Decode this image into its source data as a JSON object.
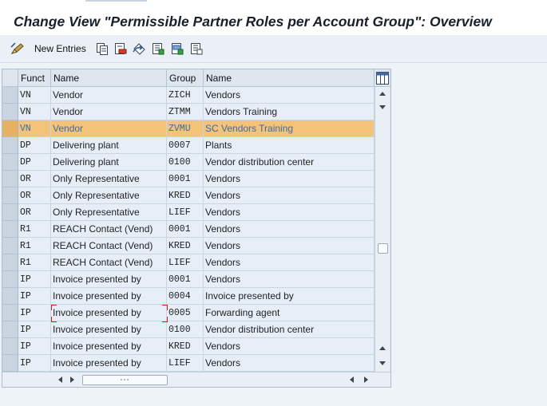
{
  "title": "Change View \"Permissible Partner Roles per Account Group\": Overview",
  "toolbar": {
    "new_entries_label": "New Entries",
    "icons": [
      "change-display-icon",
      "copy-icon",
      "delete-icon",
      "undo-icon",
      "select-all-icon",
      "select-block-icon",
      "deselect-all-icon"
    ]
  },
  "columns": [
    "Funct",
    "Name",
    "Group",
    "Name"
  ],
  "rows": [
    {
      "funct": "VN",
      "name": "Vendor",
      "group": "ZICH",
      "group_name": "Vendors",
      "selected": false
    },
    {
      "funct": "VN",
      "name": "Vendor",
      "group": "ZTMM",
      "group_name": "Vendors Training",
      "selected": false
    },
    {
      "funct": "VN",
      "name": "Vendor",
      "group": "ZVMU",
      "group_name": "SC Vendors Training",
      "selected": true
    },
    {
      "funct": "DP",
      "name": "Delivering plant",
      "group": "0007",
      "group_name": "Plants",
      "selected": false
    },
    {
      "funct": "DP",
      "name": "Delivering plant",
      "group": "0100",
      "group_name": "Vendor distribution center",
      "selected": false
    },
    {
      "funct": "OR",
      "name": "Only Representative",
      "group": "0001",
      "group_name": "Vendors",
      "selected": false
    },
    {
      "funct": "OR",
      "name": "Only Representative",
      "group": "KRED",
      "group_name": "Vendors",
      "selected": false
    },
    {
      "funct": "OR",
      "name": "Only Representative",
      "group": "LIEF",
      "group_name": "Vendors",
      "selected": false
    },
    {
      "funct": "R1",
      "name": "REACH Contact (Vend)",
      "group": "0001",
      "group_name": "Vendors",
      "selected": false
    },
    {
      "funct": "R1",
      "name": "REACH Contact (Vend)",
      "group": "KRED",
      "group_name": "Vendors",
      "selected": false
    },
    {
      "funct": "R1",
      "name": "REACH Contact (Vend)",
      "group": "LIEF",
      "group_name": "Vendors",
      "selected": false
    },
    {
      "funct": "IP",
      "name": "Invoice presented by",
      "group": "0001",
      "group_name": "Vendors",
      "selected": false
    },
    {
      "funct": "IP",
      "name": "Invoice presented by",
      "group": "0004",
      "group_name": "Invoice presented by",
      "selected": false
    },
    {
      "funct": "IP",
      "name": "Invoice presented by",
      "group": "0005",
      "group_name": "Forwarding agent",
      "selected": false
    },
    {
      "funct": "IP",
      "name": "Invoice presented by",
      "group": "0100",
      "group_name": "Vendor distribution center",
      "selected": false
    },
    {
      "funct": "IP",
      "name": "Invoice presented by",
      "group": "KRED",
      "group_name": "Vendors",
      "selected": false
    },
    {
      "funct": "IP",
      "name": "Invoice presented by",
      "group": "LIEF",
      "group_name": "Vendors",
      "selected": false
    }
  ],
  "colors": {
    "selected_row": "#f3c37a",
    "selected_text": "#3c6aa8",
    "cell_bg": "#e6eff8",
    "focus_marker": "#d02020"
  }
}
